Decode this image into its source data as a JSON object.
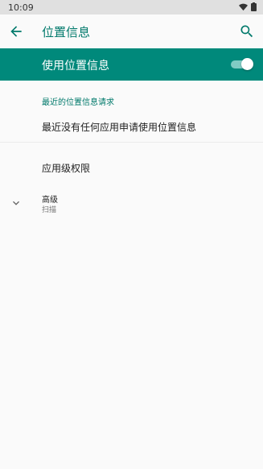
{
  "status_bar": {
    "time": "10:09"
  },
  "app_bar": {
    "title": "位置信息"
  },
  "master_switch": {
    "label": "使用位置信息",
    "enabled": true
  },
  "recent_section": {
    "title": "最近的位置信息请求",
    "empty_text": "最近没有任何应用申请使用位置信息"
  },
  "app_permissions": {
    "label": "应用级权限"
  },
  "advanced": {
    "title": "高级",
    "summary": "扫描"
  },
  "colors": {
    "accent": "#00796b",
    "master_bg": "#00897b",
    "status_bg": "#e0e0e0"
  }
}
